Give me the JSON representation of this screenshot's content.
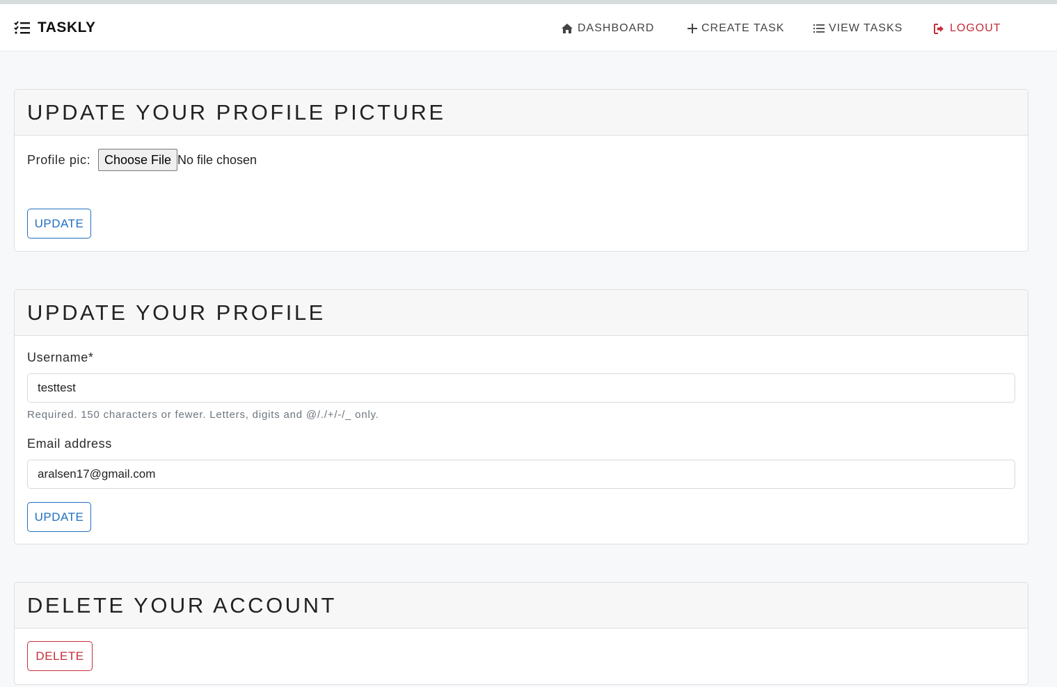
{
  "brand": {
    "name": "TASKLY",
    "icon": "checklist-icon"
  },
  "nav": {
    "dashboard": {
      "label": "DASHBOARD",
      "icon": "home-icon"
    },
    "create_task": {
      "label": "CREATE TASK",
      "icon": "plus-icon"
    },
    "view_tasks": {
      "label": "VIEW TASKS",
      "icon": "list-icon"
    },
    "logout": {
      "label": "LOGOUT",
      "icon": "sign-out-icon"
    }
  },
  "profile_picture": {
    "title": "UPDATE YOUR PROFILE PICTURE",
    "label": "Profile pic:",
    "file_button": "Choose File",
    "file_status": "No file chosen",
    "submit": "UPDATE"
  },
  "profile": {
    "title": "UPDATE YOUR PROFILE",
    "username_label": "Username*",
    "username_value": "testtest",
    "username_help": "Required. 150 characters or fewer. Letters, digits and @/./+/-/_ only.",
    "email_label": "Email address",
    "email_value": "aralsen17@gmail.com",
    "submit": "UPDATE"
  },
  "delete_account": {
    "title": "DELETE YOUR ACCOUNT",
    "submit": "DELETE"
  },
  "colors": {
    "primary": "#1f6fc0",
    "danger": "#c62c38",
    "background": "#f7f8f9"
  }
}
